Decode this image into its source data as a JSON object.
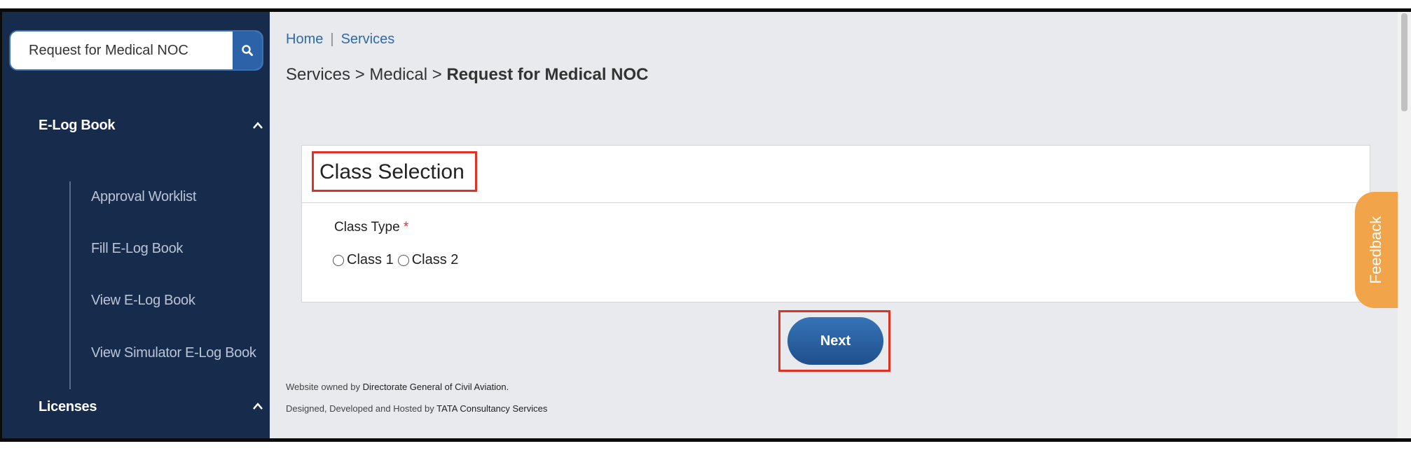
{
  "sidebar": {
    "search": {
      "value": "Request for Medical NOC"
    },
    "sections": [
      {
        "label": "E-Log Book",
        "expanded": true
      },
      {
        "label": "Licenses",
        "expanded": true
      }
    ],
    "elog_items": [
      "Approval Worklist",
      "Fill E-Log Book",
      "View E-Log Book",
      "View Simulator E-Log Book"
    ]
  },
  "breadcrumb": {
    "home": "Home",
    "separator": "|",
    "services": "Services",
    "path_prefix": "Services > Medical > ",
    "current": "Request for Medical NOC"
  },
  "panel": {
    "title": "Class Selection",
    "field_label": "Class Type",
    "required_mark": "*",
    "options": [
      "Class 1",
      "Class 2"
    ]
  },
  "actions": {
    "next_label": "Next"
  },
  "feedback": {
    "label": "Feedback"
  },
  "footer": {
    "owned_prefix": "Website owned by ",
    "owned_by": "Directorate General of Civil Aviation.",
    "designed_prefix": "Designed, Developed and Hosted by ",
    "designed_by": "TATA Consultancy Services"
  },
  "colors": {
    "sidebar_bg": "#172b4d",
    "main_bg": "#e9eaee",
    "accent": "#2b62a8",
    "highlight": "#e03224",
    "feedback": "#f2a44a"
  }
}
